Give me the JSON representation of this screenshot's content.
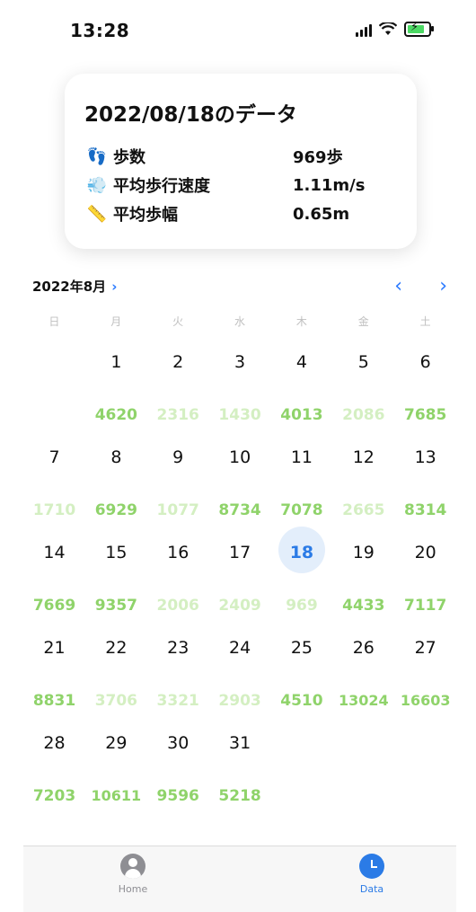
{
  "status": {
    "time": "13:28"
  },
  "card": {
    "title": "2022/08/18のデータ",
    "rows": [
      {
        "icon": "👣",
        "icon_name": "footprints-icon",
        "label": "歩数",
        "value": "969歩"
      },
      {
        "icon": "💨",
        "icon_name": "wind-icon",
        "label": "平均歩行速度",
        "value": "1.11m/s"
      },
      {
        "icon": "📏",
        "icon_name": "ruler-icon",
        "label": "平均歩幅",
        "value": "0.65m"
      }
    ]
  },
  "calendar": {
    "month_label": "2022年8月",
    "chevron": "›",
    "prev": "‹",
    "next": "›",
    "weekdays": [
      "日",
      "月",
      "火",
      "水",
      "木",
      "金",
      "土"
    ],
    "selected_day": "18",
    "weeks": [
      [
        {
          "day": "",
          "steps": ""
        },
        {
          "day": "1",
          "steps": "4620"
        },
        {
          "day": "2",
          "steps": "2316"
        },
        {
          "day": "3",
          "steps": "1430"
        },
        {
          "day": "4",
          "steps": "4013"
        },
        {
          "day": "5",
          "steps": "2086"
        },
        {
          "day": "6",
          "steps": "7685"
        }
      ],
      [
        {
          "day": "7",
          "steps": "1710"
        },
        {
          "day": "8",
          "steps": "6929"
        },
        {
          "day": "9",
          "steps": "1077"
        },
        {
          "day": "10",
          "steps": "8734"
        },
        {
          "day": "11",
          "steps": "7078"
        },
        {
          "day": "12",
          "steps": "2665"
        },
        {
          "day": "13",
          "steps": "8314"
        }
      ],
      [
        {
          "day": "14",
          "steps": "7669"
        },
        {
          "day": "15",
          "steps": "9357"
        },
        {
          "day": "16",
          "steps": "2006"
        },
        {
          "day": "17",
          "steps": "2409"
        },
        {
          "day": "18",
          "steps": "969"
        },
        {
          "day": "19",
          "steps": "4433"
        },
        {
          "day": "20",
          "steps": "7117"
        }
      ],
      [
        {
          "day": "21",
          "steps": "8831"
        },
        {
          "day": "22",
          "steps": "3706"
        },
        {
          "day": "23",
          "steps": "3321"
        },
        {
          "day": "24",
          "steps": "2903"
        },
        {
          "day": "25",
          "steps": "4510"
        },
        {
          "day": "26",
          "steps": "13024"
        },
        {
          "day": "27",
          "steps": "16603"
        }
      ],
      [
        {
          "day": "28",
          "steps": "7203"
        },
        {
          "day": "29",
          "steps": "10611"
        },
        {
          "day": "30",
          "steps": "9596"
        },
        {
          "day": "31",
          "steps": "5218"
        },
        {
          "day": "",
          "steps": ""
        },
        {
          "day": "",
          "steps": ""
        },
        {
          "day": "",
          "steps": ""
        }
      ]
    ]
  },
  "tabs": [
    {
      "label": "Home",
      "icon": "person-icon"
    },
    {
      "label": "Data",
      "icon": "clock-icon"
    }
  ],
  "colors": {
    "accent": "#2b7be6",
    "steps_strong": "#8fd36a",
    "steps_light": "#d4efc2"
  }
}
